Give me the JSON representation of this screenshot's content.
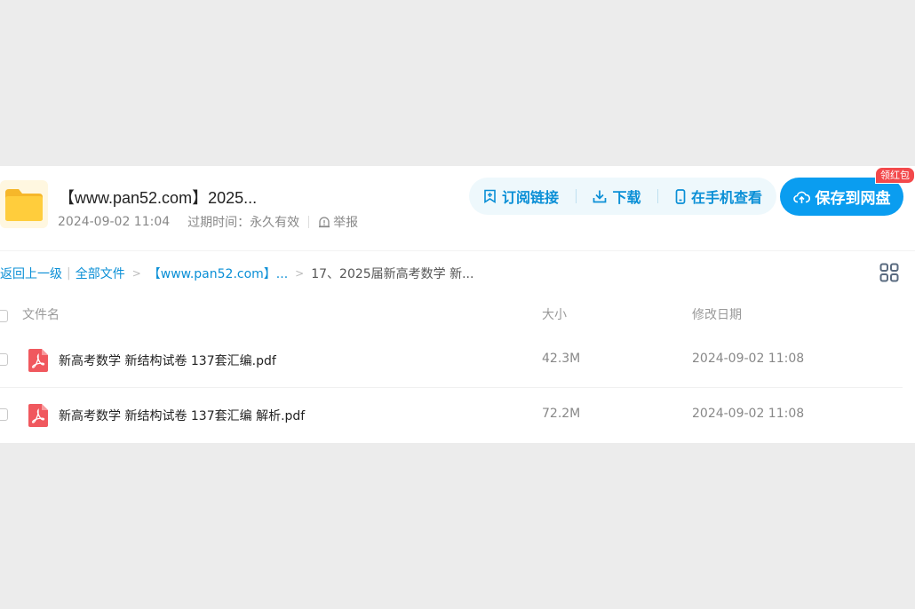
{
  "header": {
    "title": "【www.pan52.com】2025...",
    "share_date": "2024-09-02 11:04",
    "expire_label": "过期时间：永久有效",
    "report_label": "举报"
  },
  "actions": {
    "subscribe": "订阅链接",
    "download": "下载",
    "phone_view": "在手机查看",
    "save": "保存到网盘",
    "badge": "领红包"
  },
  "breadcrumb": {
    "back": "返回上一级",
    "all_files": "全部文件",
    "folder": "【www.pan52.com】...",
    "current": "17、2025届新高考数学 新..."
  },
  "table": {
    "columns": [
      "文件名",
      "大小",
      "修改日期"
    ],
    "rows": [
      {
        "name": "新高考数学 新结构试卷 137套汇编.pdf",
        "size": "42.3M",
        "date": "2024-09-02 11:08"
      },
      {
        "name": "新高考数学 新结构试卷 137套汇编 解析.pdf",
        "size": "72.2M",
        "date": "2024-09-02 11:08"
      }
    ]
  },
  "icons": {
    "folder": "folder-icon",
    "pdf": "pdf-icon",
    "subscribe": "bookmark-add-icon",
    "download": "download-icon",
    "phone": "phone-icon",
    "save": "cloud-save-icon",
    "report": "alert-icon",
    "grid": "grid-view-icon"
  },
  "colors": {
    "accent": "#0a9df0",
    "link": "#0a8fd6",
    "badge": "#f3494b",
    "pdf": "#f0585e"
  }
}
